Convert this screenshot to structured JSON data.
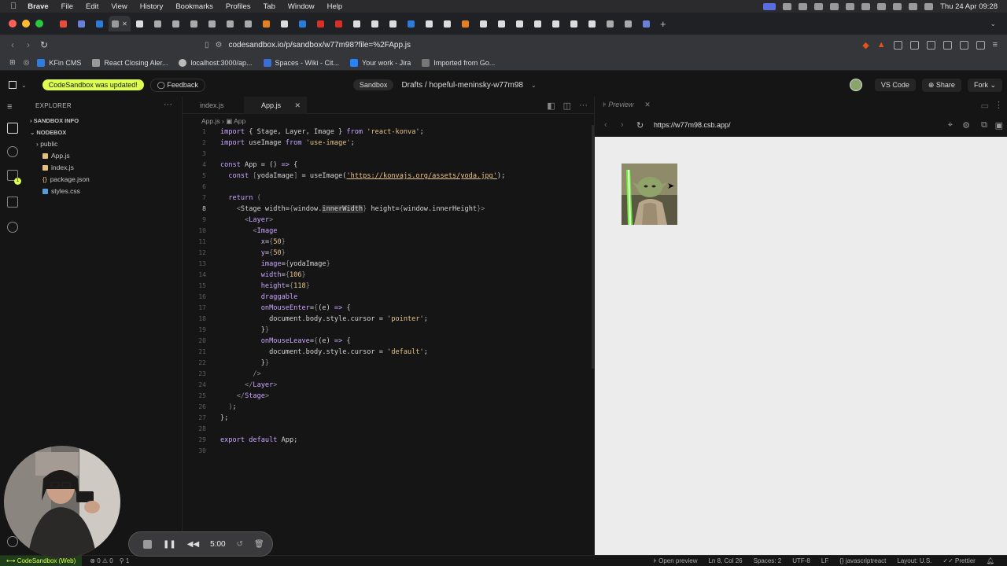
{
  "menubar": {
    "app": "Brave",
    "items": [
      "File",
      "Edit",
      "View",
      "History",
      "Bookmarks",
      "Profiles",
      "Tab",
      "Window",
      "Help"
    ],
    "datetime": "Thu 24 Apr 09:28"
  },
  "browser": {
    "url": "codesandbox.io/p/sandbox/w77m98?file=%2FApp.js",
    "bookmarks": [
      "KFin CMS",
      "React Closing Aler...",
      "localhost:3000/ap...",
      "Spaces - Wiki - Cit...",
      "Your work - Jira",
      "Imported from Go..."
    ]
  },
  "csb": {
    "update_banner": "CodeSandbox was updated!",
    "feedback": "Feedback",
    "sandbox_badge": "Sandbox",
    "breadcrumb": "Drafts / hopeful-meninsky-w77m98",
    "vscode": "VS Code",
    "share": "Share",
    "fork": "Fork"
  },
  "explorer": {
    "title": "EXPLORER",
    "sections": [
      "SANDBOX INFO",
      "NODEBOX"
    ],
    "files": [
      "public",
      "App.js",
      "index.js",
      "package.json",
      "styles.css"
    ]
  },
  "editor": {
    "tabs": [
      "index.js",
      "App.js"
    ],
    "breadcrumb_file": "App.js",
    "breadcrumb_symbol": "App",
    "line_numbers": [
      "1",
      "2",
      "3",
      "4",
      "5",
      "6",
      "7",
      "8",
      "9",
      "10",
      "11",
      "12",
      "13",
      "14",
      "15",
      "16",
      "17",
      "18",
      "19",
      "20",
      "21",
      "22",
      "23",
      "24",
      "25",
      "26",
      "27",
      "28",
      "29",
      "30"
    ]
  },
  "preview": {
    "tab": "Preview",
    "url": "https://w77m98.csb.app/"
  },
  "statusbar": {
    "left": "CodeSandbox (Web)",
    "problems": "0 ⚠ 0",
    "ports": "1",
    "open_preview": "Open preview",
    "position": "Ln 8, Col 26",
    "spaces": "Spaces: 2",
    "encoding": "UTF-8",
    "eol": "LF",
    "language": "javascriptreact",
    "layout": "Layout: U.S.",
    "formatter": "Prettier"
  },
  "recorder": {
    "time": "5:00"
  }
}
